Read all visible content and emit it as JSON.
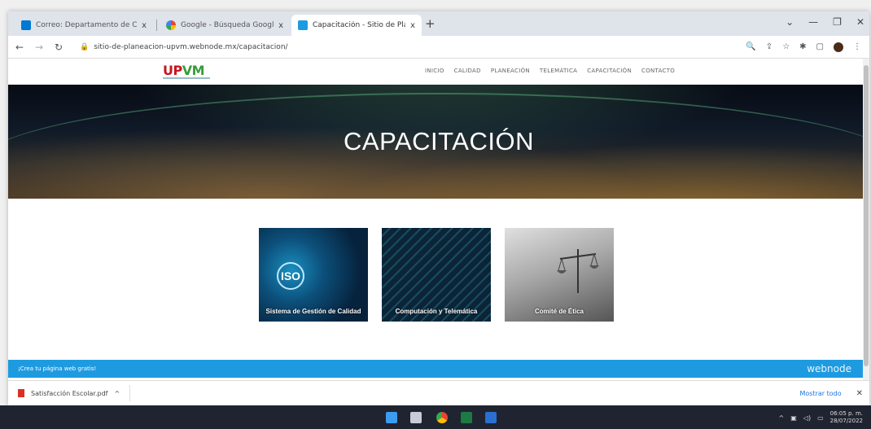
{
  "browser": {
    "tabs": [
      {
        "title": "Correo: Departamento de Calid",
        "close": "x"
      },
      {
        "title": "Google - Búsqueda Google",
        "close": "x"
      },
      {
        "title": "Capacitación - Sitio de Planeación",
        "close": "x"
      }
    ],
    "new_tab": "+",
    "window_controls": [
      "⌄",
      "—",
      "❐",
      "✕"
    ],
    "address": "sitio-de-planeacion-upvm.webnode.mx/capacitacion/"
  },
  "site": {
    "logo": {
      "text_a": "UP",
      "text_b": "VM"
    },
    "menu": [
      "INICIO",
      "CALIDAD",
      "PLANEACIÓN",
      "TELEMÁTICA",
      "CAPACITACIÓN",
      "CONTACTO"
    ],
    "hero_title": "CAPACITACIÓN",
    "cards": [
      {
        "caption": "Sistema de Gestión de Calidad",
        "badge": "ISO"
      },
      {
        "caption": "Computación y Telemática"
      },
      {
        "caption": "Comité de Ética"
      }
    ],
    "webnode_bar": {
      "text": "¡Crea tu página web gratis!",
      "brand": "webnode"
    }
  },
  "downloads": {
    "file": "Satisfacción Escolar.pdf",
    "chevron": "^",
    "show_all": "Mostrar todo",
    "close": "✕"
  },
  "taskbar": {
    "time": "06:05 p. m.",
    "date": "28/07/2022"
  },
  "colors": {
    "webnode_blue": "#1e9be0",
    "logo_red": "#c4161c",
    "logo_green": "#3a9b3a"
  }
}
